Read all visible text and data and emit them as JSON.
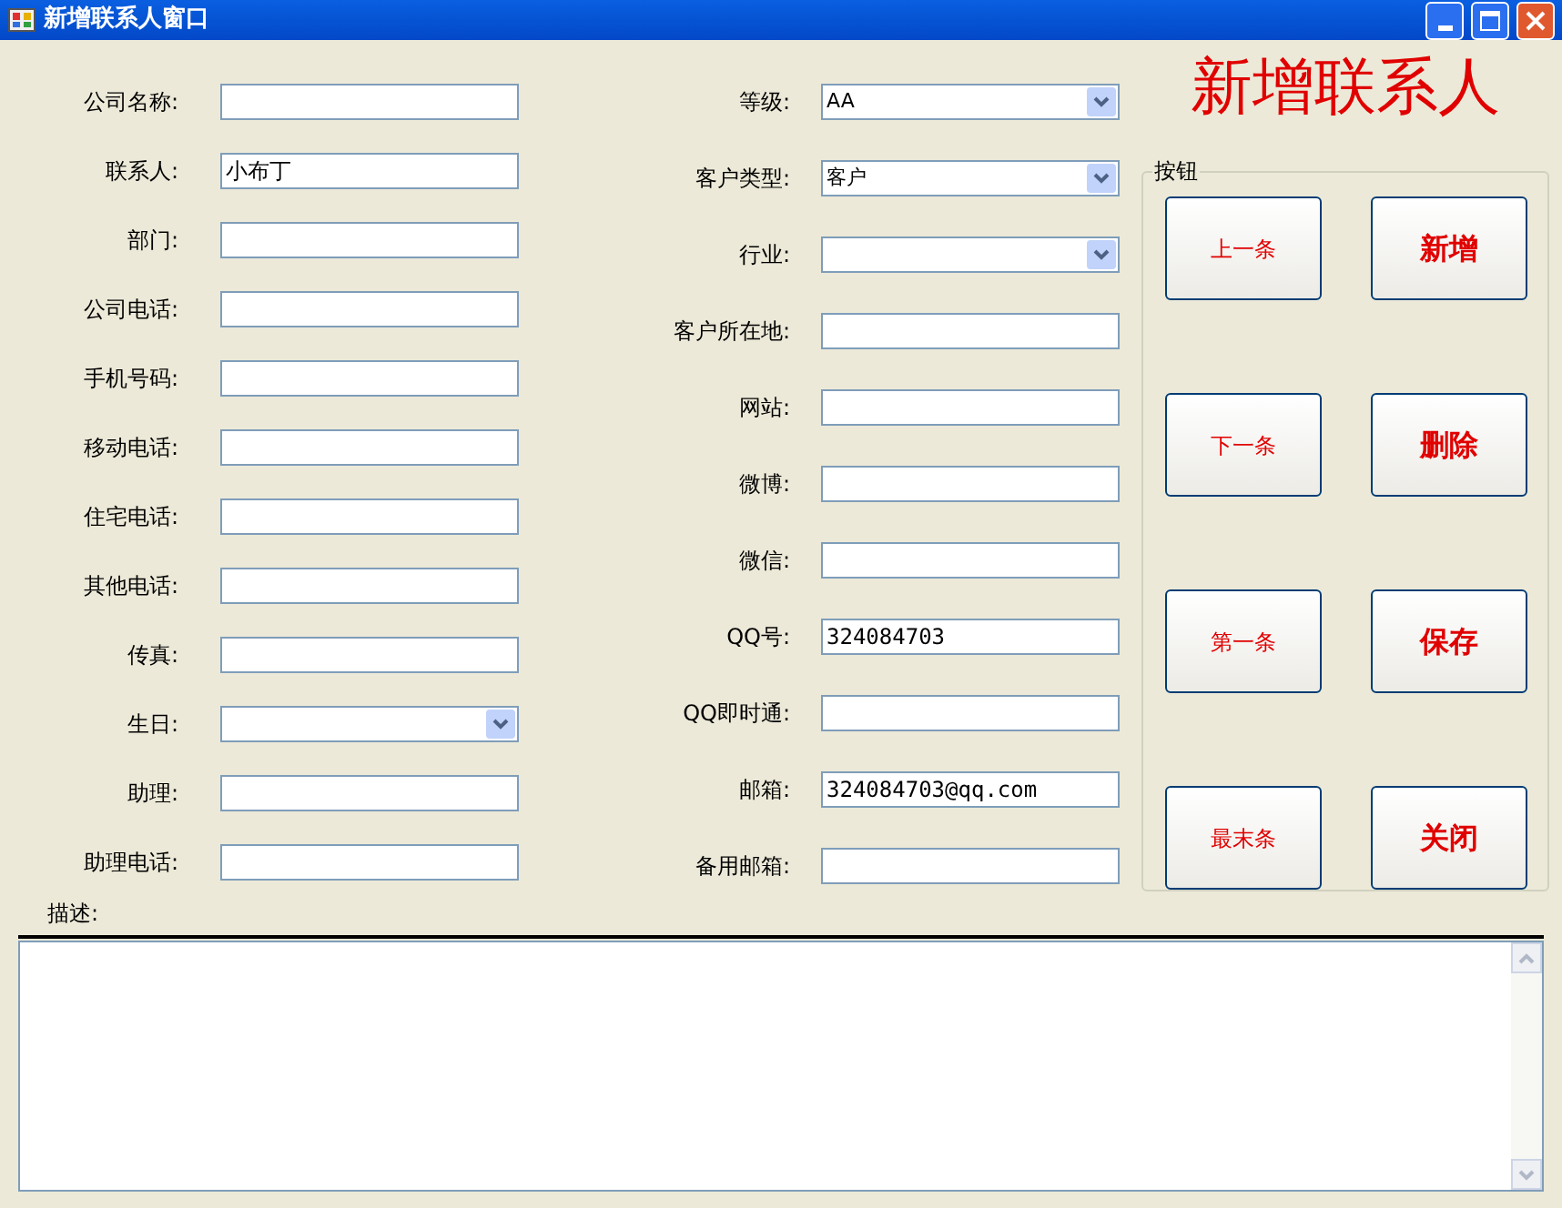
{
  "window": {
    "title": "新增联系人窗口"
  },
  "heading": "新增联系人",
  "left_fields": [
    {
      "label": "公司名称:",
      "kind": "text"
    },
    {
      "label": "联系人:",
      "kind": "text",
      "value": "小布丁"
    },
    {
      "label": "部门:",
      "kind": "text"
    },
    {
      "label": "公司电话:",
      "kind": "text"
    },
    {
      "label": "手机号码:",
      "kind": "text"
    },
    {
      "label": "移动电话:",
      "kind": "text"
    },
    {
      "label": "住宅电话:",
      "kind": "text"
    },
    {
      "label": "其他电话:",
      "kind": "text"
    },
    {
      "label": "传真:",
      "kind": "text"
    },
    {
      "label": "生日:",
      "kind": "dropdown"
    },
    {
      "label": "助理:",
      "kind": "text"
    },
    {
      "label": "助理电话:",
      "kind": "text"
    }
  ],
  "middle_fields": [
    {
      "label": "等级:",
      "kind": "dropdown",
      "value": "AA"
    },
    {
      "label": "客户类型:",
      "kind": "dropdown",
      "value": "客户"
    },
    {
      "label": "行业:",
      "kind": "dropdown"
    },
    {
      "label": "客户所在地:",
      "kind": "text"
    },
    {
      "label": "网站:",
      "kind": "text"
    },
    {
      "label": "微博:",
      "kind": "text"
    },
    {
      "label": "微信:",
      "kind": "text"
    },
    {
      "label": "QQ号:",
      "kind": "text",
      "value": "324084703"
    },
    {
      "label": "QQ即时通:",
      "kind": "text"
    },
    {
      "label": "邮箱:",
      "kind": "text",
      "value": "324084703@qq.com"
    },
    {
      "label": "备用邮箱:",
      "kind": "text"
    }
  ],
  "button_group": {
    "title": "按钮",
    "buttons": [
      {
        "label": "上一条",
        "kind": "nav"
      },
      {
        "label": "新增",
        "kind": "action"
      },
      {
        "label": "下一条",
        "kind": "nav"
      },
      {
        "label": "删除",
        "kind": "action"
      },
      {
        "label": "第一条",
        "kind": "nav"
      },
      {
        "label": "保存",
        "kind": "action"
      },
      {
        "label": "最末条",
        "kind": "nav"
      },
      {
        "label": "关闭",
        "kind": "action"
      }
    ]
  },
  "description": {
    "label": "描述:"
  }
}
